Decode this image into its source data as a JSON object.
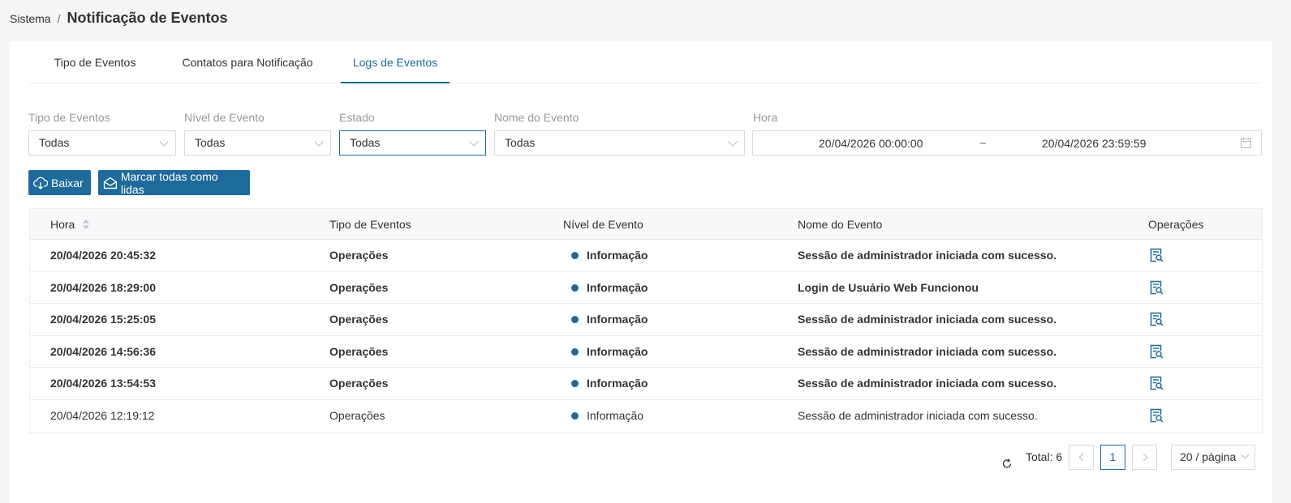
{
  "breadcrumb": {
    "root": "Sistema",
    "separator": "/",
    "title": "Notificação de Eventos"
  },
  "tabs": [
    {
      "label": "Tipo de Eventos",
      "active": false
    },
    {
      "label": "Contatos para Notificação",
      "active": false
    },
    {
      "label": "Logs de Eventos",
      "active": true
    }
  ],
  "filters": {
    "tipo": {
      "label": "Tipo de Eventos",
      "value": "Todas"
    },
    "nivel": {
      "label": "Nível de Evento",
      "value": "Todas"
    },
    "estado": {
      "label": "Estado",
      "value": "Todas"
    },
    "nome": {
      "label": "Nome do Evento",
      "value": "Todas"
    },
    "hora": {
      "label": "Hora",
      "start": "20/04/2026 00:00:00",
      "separator": "~",
      "end": "20/04/2026 23:59:59"
    }
  },
  "actions": {
    "download": "Baixar",
    "mark_all_read": "Marcar todas como lidas"
  },
  "table": {
    "columns": [
      "Hora",
      "Tipo de Eventos",
      "Nível de Evento",
      "Nome do Evento",
      "Operações"
    ],
    "rows": [
      {
        "hora": "20/04/2026 20:45:32",
        "tipo": "Operações",
        "nivel": "Informação",
        "nome": "Sessão de administrador iniciada com sucesso.",
        "unread": true
      },
      {
        "hora": "20/04/2026 18:29:00",
        "tipo": "Operações",
        "nivel": "Informação",
        "nome": "Login de Usuário Web Funcionou",
        "unread": true
      },
      {
        "hora": "20/04/2026 15:25:05",
        "tipo": "Operações",
        "nivel": "Informação",
        "nome": "Sessão de administrador iniciada com sucesso.",
        "unread": true
      },
      {
        "hora": "20/04/2026 14:56:36",
        "tipo": "Operações",
        "nivel": "Informação",
        "nome": "Sessão de administrador iniciada com sucesso.",
        "unread": true
      },
      {
        "hora": "20/04/2026 13:54:53",
        "tipo": "Operações",
        "nivel": "Informação",
        "nome": "Sessão de administrador iniciada com sucesso.",
        "unread": true
      },
      {
        "hora": "20/04/2026 12:19:12",
        "tipo": "Operações",
        "nivel": "Informação",
        "nome": "Sessão de administrador iniciada com sucesso.",
        "unread": false
      }
    ]
  },
  "pagination": {
    "total": "Total: 6",
    "current_page": "1",
    "page_size": "20 / página"
  },
  "colors": {
    "accent": "#1e6a9b",
    "info_dot": "#1e6a9b"
  },
  "icons": {
    "refresh": "refresh-icon",
    "details": "details-icon",
    "download": "cloud-download-icon",
    "mark_read": "mail-open-icon",
    "calendar": "calendar-icon"
  }
}
